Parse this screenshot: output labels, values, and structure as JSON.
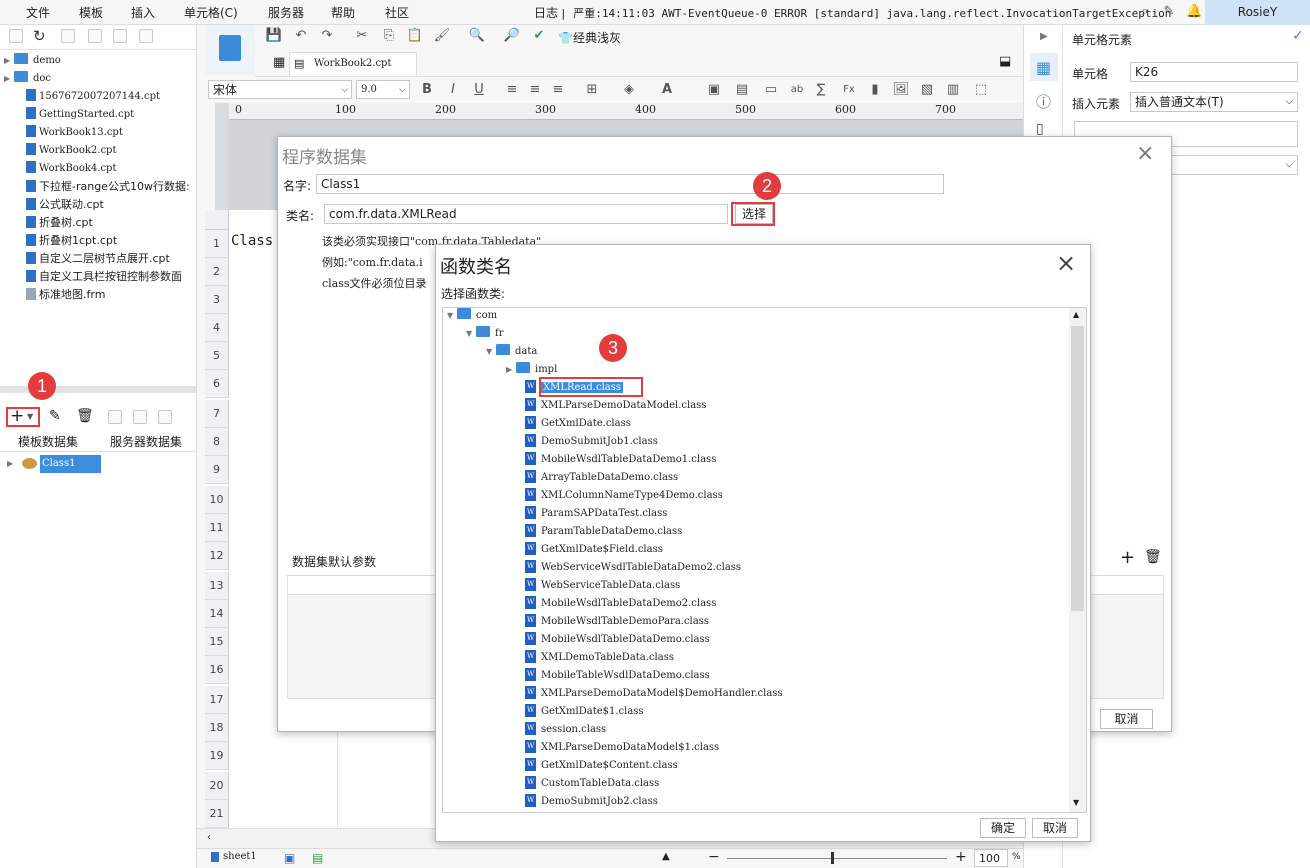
{
  "menu": {
    "items": [
      "文件",
      "模板",
      "插入",
      "单元格(C)",
      "服务器",
      "帮助",
      "社区"
    ],
    "log_label": "日志",
    "log_message": "| 严重:14:11:03 AWT-EventQueue-0 ERROR [standard] java.lang.reflect.InvocationTargetException",
    "user": "RosieY"
  },
  "file_tree": {
    "folders": [
      "demo",
      "doc"
    ],
    "files": [
      "1567672007207144.cpt",
      "GettingStarted.cpt",
      "WorkBook13.cpt",
      "WorkBook2.cpt",
      "WorkBook4.cpt",
      "下拉框-range公式10w行数据:",
      "公式联动.cpt",
      "折叠树.cpt",
      "折叠树1cpt.cpt",
      "自定义二层树节点展开.cpt",
      "自定义工具栏按钮控制参数面",
      "标准地图.frm"
    ]
  },
  "datasets": {
    "tab_template": "模板数据集",
    "tab_server": "服务器数据集",
    "items": [
      "Class1"
    ]
  },
  "editor": {
    "tab": "WorkBook2.cpt",
    "font": "宋体",
    "font_size": "9.0",
    "ruler": [
      "0",
      "100",
      "200",
      "300",
      "400",
      "500",
      "600",
      "700"
    ],
    "style_label": "经典浅灰",
    "cell_a1": "Class",
    "rows": [
      "1",
      "2",
      "3",
      "4",
      "5",
      "6",
      "7",
      "8",
      "9",
      "10",
      "11",
      "12",
      "13",
      "14",
      "15",
      "16",
      "17",
      "18",
      "19",
      "20",
      "21"
    ],
    "sheet_tab": "sheet1",
    "zoom": "100",
    "zoom_unit": "%"
  },
  "right_panel": {
    "title": "单元格元素",
    "cell_label": "单元格",
    "cell_value": "K26",
    "insert_label": "插入元素",
    "insert_value": "插入普通文本(T)"
  },
  "program_dataset": {
    "title": "程序数据集",
    "name_label": "名字:",
    "name_value": "Class1",
    "class_label": "类名:",
    "class_value": "com.fr.data.XMLRead",
    "select_button": "选择",
    "hint1": "该类必须实现接口\"com.fr.data.Tabledata\"",
    "hint2": "例如:\"com.fr.data.i",
    "hint3": "class文件必须位目录",
    "params_label": "数据集默认参数",
    "cancel": "取消"
  },
  "class_dialog": {
    "title": "函数类名",
    "subtitle": "选择函数类:",
    "tree_root": [
      "com",
      "fr",
      "data",
      "impl"
    ],
    "classes": [
      "XMLRead.class",
      "XMLParseDemoDataModel.class",
      "GetXmlDate.class",
      "DemoSubmitJob1.class",
      "MobileWsdlTableDataDemo1.class",
      "ArrayTableDataDemo.class",
      "XMLColumnNameType4Demo.class",
      "ParamSAPDataTest.class",
      "ParamTableDataDemo.class",
      "GetXmlDate$Field.class",
      "WebServiceWsdlTableDataDemo2.class",
      "WebServiceTableData.class",
      "MobileWsdlTableDataDemo2.class",
      "MobileWsdlTableDemoPara.class",
      "MobileWsdlTableDataDemo.class",
      "XMLDemoTableData.class",
      "MobileTableWsdlDataDemo.class",
      "XMLParseDemoDataModel$DemoHandler.class",
      "GetXmlDate$1.class",
      "session.class",
      "XMLParseDemoDataModel$1.class",
      "GetXmlDate$Content.class",
      "CustomTableData.class",
      "DemoSubmitJob2.class"
    ],
    "ok": "确定",
    "cancel": "取消"
  },
  "badges": [
    "1",
    "2",
    "3"
  ],
  "colors": {
    "accent": "#3b8bd9",
    "highlight": "#e43c3c",
    "selection": "#3c8de0"
  }
}
